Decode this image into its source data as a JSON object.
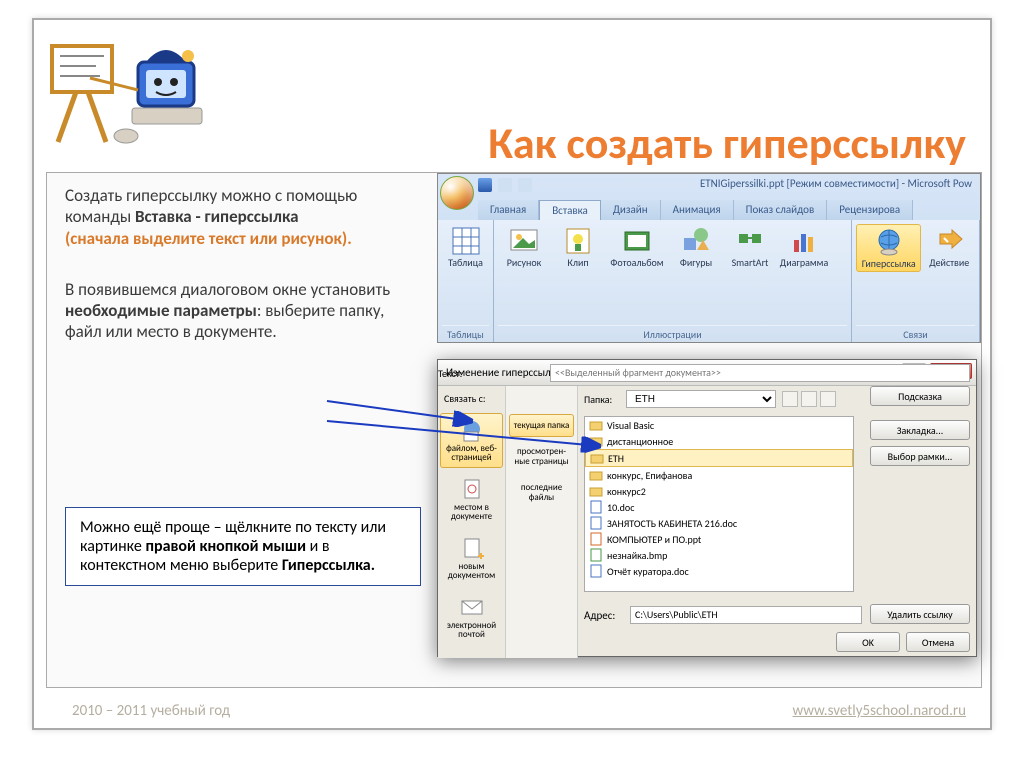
{
  "slide": {
    "title": "Как создать гиперссылку"
  },
  "text": {
    "p1_a": "Создать гиперссылку можно с помощью команды ",
    "p1_b": "Вставка  - гиперссылка",
    "p1_c": "(сначала выделите текст или рисунок).",
    "p2_a": "В появившемся диалоговом окне установить ",
    "p2_b": "необходимые параметры",
    "p2_c": ": выберите папку, файл или место в документе.",
    "tip_a": "Можно ещё проще – щёлкните по тексту или картинке ",
    "tip_b": "правой кнопкой мыши",
    "tip_c": " и в контекстном меню выберите ",
    "tip_d": "Гиперссылка."
  },
  "ribbon": {
    "doc_title": "ETNIGiperssilki.ppt [Режим совместимости] - Microsoft Pow",
    "tabs": [
      "Главная",
      "Вставка",
      "Дизайн",
      "Анимация",
      "Показ слайдов",
      "Рецензирова"
    ],
    "active_tab": 1,
    "groups": {
      "tables": {
        "label": "Таблицы",
        "items": [
          "Таблица"
        ]
      },
      "illustrations": {
        "label": "Иллюстрации",
        "items": [
          "Рисунок",
          "Клип",
          "Фотоальбом",
          "Фигуры",
          "SmartArt",
          "Диаграмма"
        ]
      },
      "links": {
        "label": "Связи",
        "items": [
          "Гиперссылка",
          "Действие"
        ]
      }
    }
  },
  "dialog": {
    "title": "Изменение гиперссылки",
    "link_label": "Связать с:",
    "text_label": "Текст:",
    "text_value": "<<Выделенный фрагмент документа>>",
    "folder_label": "Папка:",
    "folder_value": "ETH",
    "left_items": [
      "файлом, веб-страницей",
      "местом в документе",
      "новым документом",
      "электронной почтой"
    ],
    "mid_items": [
      "текущая папка",
      "просмотрен-ные страницы",
      "последние файлы"
    ],
    "files": [
      "Visual Basic",
      "дистанционное",
      "ETH",
      "конкурс, Епифанова",
      "конкурс2",
      "10.doc",
      "ЗАНЯТОСТЬ КАБИНЕТА   216.doc",
      "КОМПЬЮТЕР и ПО.ppt",
      "незнайка.bmp",
      "Отчёт куратора.doc"
    ],
    "address_label": "Адрес:",
    "address_value": "C:\\Users\\Public\\ETH",
    "btn_hint": "Подсказка",
    "btn_bookmark": "Закладка...",
    "btn_frame": "Выбор рамки...",
    "btn_remove": "Удалить ссылку",
    "btn_ok": "OK",
    "btn_cancel": "Отмена"
  },
  "footer": {
    "left": "2010 – 2011 учебный год",
    "right": "www.svetly5school.narod.ru"
  }
}
